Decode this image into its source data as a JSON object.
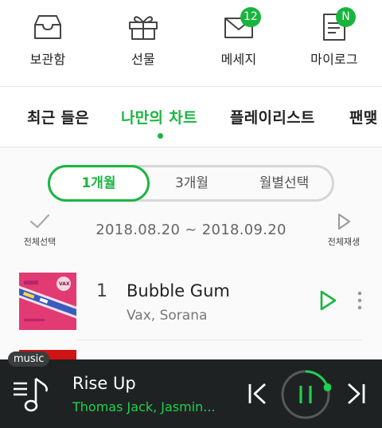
{
  "top_menu": [
    {
      "label": "보관함",
      "icon": "storage-box-icon"
    },
    {
      "label": "선물",
      "icon": "gift-icon"
    },
    {
      "label": "메세지",
      "icon": "mail-icon",
      "badge": "12"
    },
    {
      "label": "마이로그",
      "icon": "mylog-document-icon",
      "badge": "N"
    }
  ],
  "tabs": [
    "최근 들은",
    "나만의 차트",
    "플레이리스트",
    "팬맺"
  ],
  "active_tab": "나만의 차트",
  "period_options": [
    "1개월",
    "3개월",
    "월별선택"
  ],
  "active_period": "1개월",
  "select_all_label": "전체선택",
  "play_all_label": "전체재생",
  "date_range": "2018.08.20 ~ 2018.09.20",
  "songs": [
    {
      "rank": "1",
      "title": "Bubble Gum",
      "artist": "Vax, Sorana",
      "album_art_label": "VAX"
    }
  ],
  "player": {
    "tag": "music",
    "title": "Rise Up",
    "artist": "Thomas Jack, Jasmin...",
    "progress": 0.2
  },
  "colors": {
    "accent": "#1ab540",
    "player_bg": "#1f2222",
    "player_artist": "#1ed14f"
  }
}
